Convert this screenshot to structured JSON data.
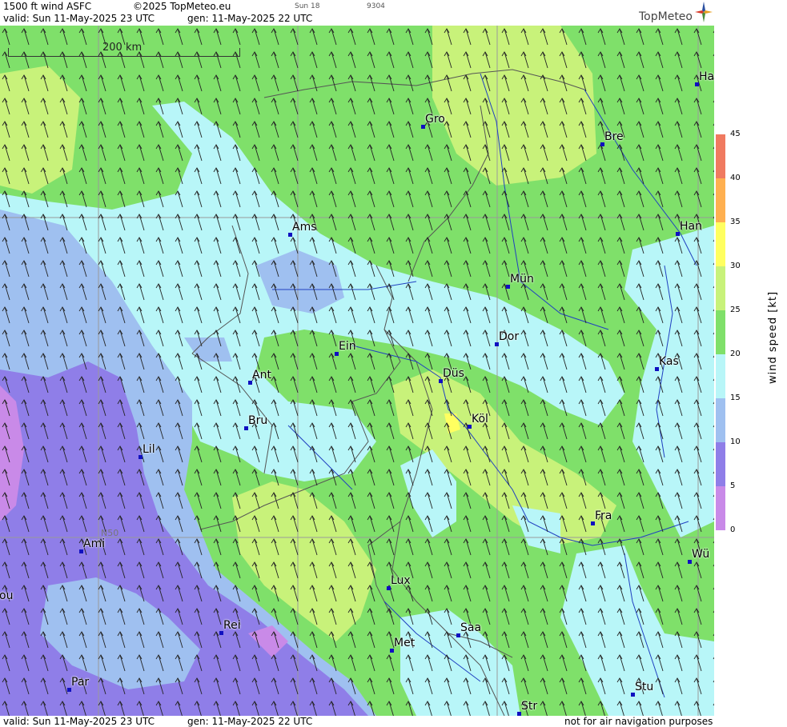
{
  "header": {
    "product": "1500 ft wind ASFC",
    "copyright": "©2025 TopMeteo.eu",
    "day_code": "Sun 18",
    "code": "9304",
    "valid": "valid:  Sun  11-May-2025  23 UTC",
    "gen": "gen: 11-May-2025 22 UTC",
    "brand": "TopMeteo"
  },
  "footer": {
    "valid": "valid:  Sun  11-May-2025  23 UTC",
    "gen": "gen: 11-May-2025 22 UTC",
    "disclaimer": "not for air navigation purposes"
  },
  "scale_bar": {
    "label": "200 km"
  },
  "grid_label": "N50",
  "colorbar": {
    "label": "wind speed  [kt]",
    "ticks": [
      "45",
      "40",
      "35",
      "30",
      "25",
      "20",
      "15",
      "10",
      "5",
      "0"
    ],
    "colors": {
      "0-5": "#c98ae8",
      "5-10": "#8f7ee8",
      "10-15": "#9fc0f0",
      "15-20": "#b8f6f8",
      "20-25": "#7fe06a",
      "25-30": "#c8f27a",
      "30-35": "#ffff60",
      "35-40": "#ffb050",
      "40-45": "#f07a60"
    }
  },
  "cities": [
    {
      "name": "Ha"
    },
    {
      "name": "Gro"
    },
    {
      "name": "Bre"
    },
    {
      "name": "Ams"
    },
    {
      "name": "Han"
    },
    {
      "name": "Mün"
    },
    {
      "name": "Ein"
    },
    {
      "name": "Dor"
    },
    {
      "name": "Ant"
    },
    {
      "name": "Kas"
    },
    {
      "name": "Düs"
    },
    {
      "name": "Bru"
    },
    {
      "name": "Köl"
    },
    {
      "name": "Lil"
    },
    {
      "name": "Fra"
    },
    {
      "name": "Ami"
    },
    {
      "name": "Wü"
    },
    {
      "name": "Lux"
    },
    {
      "name": "Saa"
    },
    {
      "name": "ou"
    },
    {
      "name": "Rei"
    },
    {
      "name": "Met"
    },
    {
      "name": "Stu"
    },
    {
      "name": "Par"
    },
    {
      "name": "Str"
    }
  ]
}
